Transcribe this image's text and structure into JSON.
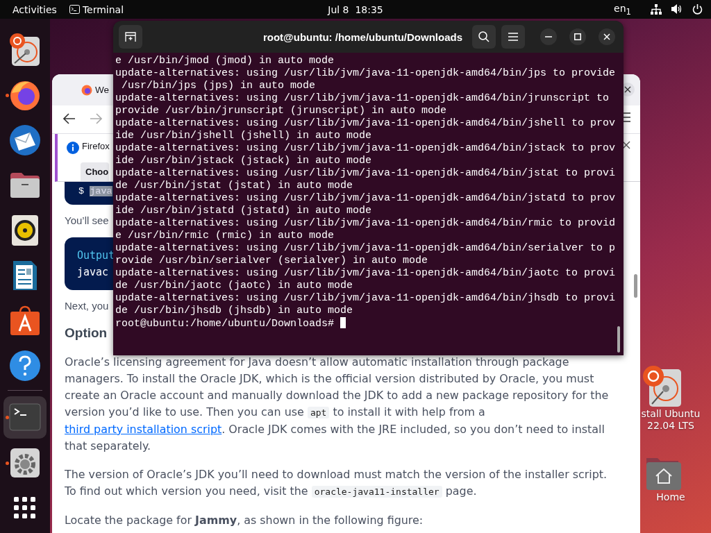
{
  "top_bar": {
    "activities": "Activities",
    "app": "Terminal",
    "clock": "Jul 8  18:35",
    "input_source": "en$_{1}$"
  },
  "dock": {
    "items": [
      {
        "kind": "installer",
        "running": false,
        "selected": false
      },
      {
        "kind": "firefox",
        "running": true,
        "selected": false
      },
      {
        "kind": "mail",
        "running": false,
        "selected": false
      },
      {
        "kind": "files",
        "running": false,
        "selected": false
      },
      {
        "kind": "music",
        "running": false,
        "selected": false
      },
      {
        "kind": "writer",
        "running": false,
        "selected": false
      },
      {
        "kind": "software",
        "running": false,
        "selected": false
      },
      {
        "kind": "help",
        "running": false,
        "selected": false
      },
      {
        "kind": "terminal",
        "running": true,
        "selected": true
      },
      {
        "kind": "settings",
        "running": true,
        "selected": false
      },
      {
        "kind": "apps",
        "running": false,
        "selected": false
      }
    ]
  },
  "desktop_icons": [
    {
      "kind": "installer",
      "label": "stall Ubuntu 22.04 LTS"
    },
    {
      "kind": "home",
      "label": "Home"
    }
  ],
  "browser": {
    "tab": {
      "title": "We"
    },
    "nav": {
      "forward_disabled": true
    },
    "notification": {
      "message": "Firefox",
      "button": "Choo"
    },
    "content": [
      {
        "kind": "command",
        "prompt": "$",
        "command": "java",
        "selected": true
      },
      {
        "kind": "text",
        "text": "You’ll see"
      },
      {
        "kind": "output",
        "label": "Output",
        "lines": [
          "javac"
        ]
      },
      {
        "kind": "text",
        "text": "Next, you"
      },
      {
        "kind": "heading",
        "text": "Option"
      },
      {
        "kind": "paragraph",
        "parts": [
          {
            "kind": "text",
            "text": "Oracle’s licensing agreement for Java doesn’t allow automatic installation through package managers. To install the Oracle JDK, which is the official version distributed by Oracle, you must create an Oracle account and manually download the JDK to add a new package repository for the version you’d like to use. Then you can use "
          },
          {
            "kind": "code",
            "text": "apt"
          },
          {
            "kind": "text",
            "text": " to install it with help from a "
          },
          {
            "kind": "link",
            "text": "third party installation script"
          },
          {
            "kind": "text",
            "text": ". Oracle JDK comes with the JRE included, so you don’t need to install that separately."
          }
        ]
      },
      {
        "kind": "paragraph",
        "parts": [
          {
            "kind": "text",
            "text": "The version of Oracle’s JDK you’ll need to download must match the version of the installer script. To find out which version you need, visit the "
          },
          {
            "kind": "code",
            "text": "oracle-java11-installer"
          },
          {
            "kind": "text",
            "text": " page."
          }
        ]
      },
      {
        "kind": "paragraph",
        "parts": [
          {
            "kind": "text",
            "text": "Locate the package for **Jammy**, as shown in the following figure:"
          }
        ]
      }
    ]
  },
  "terminal": {
    "title": "root@ubuntu: /home/ubuntu/Downloads",
    "lines": [
      "e /usr/bin/jmod (jmod) in auto mode",
      "update-alternatives: using /usr/lib/jvm/java-11-openjdk-amd64/bin/jps to provide",
      " /usr/bin/jps (jps) in auto mode",
      "update-alternatives: using /usr/lib/jvm/java-11-openjdk-amd64/bin/jrunscript to",
      "provide /usr/bin/jrunscript (jrunscript) in auto mode",
      "update-alternatives: using /usr/lib/jvm/java-11-openjdk-amd64/bin/jshell to prov",
      "ide /usr/bin/jshell (jshell) in auto mode",
      "update-alternatives: using /usr/lib/jvm/java-11-openjdk-amd64/bin/jstack to prov",
      "ide /usr/bin/jstack (jstack) in auto mode",
      "update-alternatives: using /usr/lib/jvm/java-11-openjdk-amd64/bin/jstat to provi",
      "de /usr/bin/jstat (jstat) in auto mode",
      "update-alternatives: using /usr/lib/jvm/java-11-openjdk-amd64/bin/jstatd to prov",
      "ide /usr/bin/jstatd (jstatd) in auto mode",
      "update-alternatives: using /usr/lib/jvm/java-11-openjdk-amd64/bin/rmic to provid",
      "e /usr/bin/rmic (rmic) in auto mode",
      "update-alternatives: using /usr/lib/jvm/java-11-openjdk-amd64/bin/serialver to p",
      "rovide /usr/bin/serialver (serialver) in auto mode",
      "update-alternatives: using /usr/lib/jvm/java-11-openjdk-amd64/bin/jaotc to provi",
      "de /usr/bin/jaotc (jaotc) in auto mode",
      "update-alternatives: using /usr/lib/jvm/java-11-openjdk-amd64/bin/jhsdb to provi",
      "de /usr/bin/jhsdb (jhsdb) in auto mode"
    ],
    "prompt": "root@ubuntu:/home/ubuntu/Downloads# "
  }
}
